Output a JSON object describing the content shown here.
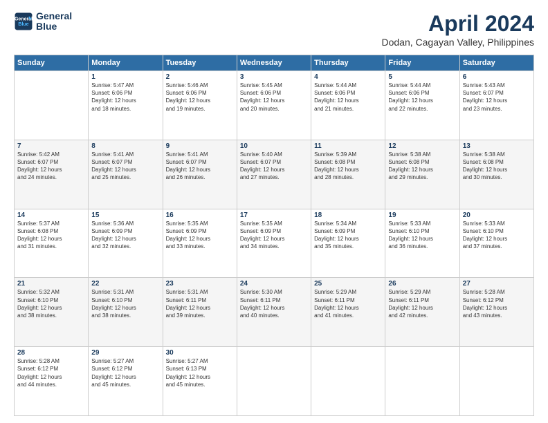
{
  "logo": {
    "line1": "General",
    "line2": "Blue"
  },
  "title": "April 2024",
  "subtitle": "Dodan, Cagayan Valley, Philippines",
  "days": [
    "Sunday",
    "Monday",
    "Tuesday",
    "Wednesday",
    "Thursday",
    "Friday",
    "Saturday"
  ],
  "weeks": [
    [
      {
        "day": "",
        "info": ""
      },
      {
        "day": "1",
        "info": "Sunrise: 5:47 AM\nSunset: 6:06 PM\nDaylight: 12 hours\nand 18 minutes."
      },
      {
        "day": "2",
        "info": "Sunrise: 5:46 AM\nSunset: 6:06 PM\nDaylight: 12 hours\nand 19 minutes."
      },
      {
        "day": "3",
        "info": "Sunrise: 5:45 AM\nSunset: 6:06 PM\nDaylight: 12 hours\nand 20 minutes."
      },
      {
        "day": "4",
        "info": "Sunrise: 5:44 AM\nSunset: 6:06 PM\nDaylight: 12 hours\nand 21 minutes."
      },
      {
        "day": "5",
        "info": "Sunrise: 5:44 AM\nSunset: 6:06 PM\nDaylight: 12 hours\nand 22 minutes."
      },
      {
        "day": "6",
        "info": "Sunrise: 5:43 AM\nSunset: 6:07 PM\nDaylight: 12 hours\nand 23 minutes."
      }
    ],
    [
      {
        "day": "7",
        "info": "Sunrise: 5:42 AM\nSunset: 6:07 PM\nDaylight: 12 hours\nand 24 minutes."
      },
      {
        "day": "8",
        "info": "Sunrise: 5:41 AM\nSunset: 6:07 PM\nDaylight: 12 hours\nand 25 minutes."
      },
      {
        "day": "9",
        "info": "Sunrise: 5:41 AM\nSunset: 6:07 PM\nDaylight: 12 hours\nand 26 minutes."
      },
      {
        "day": "10",
        "info": "Sunrise: 5:40 AM\nSunset: 6:07 PM\nDaylight: 12 hours\nand 27 minutes."
      },
      {
        "day": "11",
        "info": "Sunrise: 5:39 AM\nSunset: 6:08 PM\nDaylight: 12 hours\nand 28 minutes."
      },
      {
        "day": "12",
        "info": "Sunrise: 5:38 AM\nSunset: 6:08 PM\nDaylight: 12 hours\nand 29 minutes."
      },
      {
        "day": "13",
        "info": "Sunrise: 5:38 AM\nSunset: 6:08 PM\nDaylight: 12 hours\nand 30 minutes."
      }
    ],
    [
      {
        "day": "14",
        "info": "Sunrise: 5:37 AM\nSunset: 6:08 PM\nDaylight: 12 hours\nand 31 minutes."
      },
      {
        "day": "15",
        "info": "Sunrise: 5:36 AM\nSunset: 6:09 PM\nDaylight: 12 hours\nand 32 minutes."
      },
      {
        "day": "16",
        "info": "Sunrise: 5:35 AM\nSunset: 6:09 PM\nDaylight: 12 hours\nand 33 minutes."
      },
      {
        "day": "17",
        "info": "Sunrise: 5:35 AM\nSunset: 6:09 PM\nDaylight: 12 hours\nand 34 minutes."
      },
      {
        "day": "18",
        "info": "Sunrise: 5:34 AM\nSunset: 6:09 PM\nDaylight: 12 hours\nand 35 minutes."
      },
      {
        "day": "19",
        "info": "Sunrise: 5:33 AM\nSunset: 6:10 PM\nDaylight: 12 hours\nand 36 minutes."
      },
      {
        "day": "20",
        "info": "Sunrise: 5:33 AM\nSunset: 6:10 PM\nDaylight: 12 hours\nand 37 minutes."
      }
    ],
    [
      {
        "day": "21",
        "info": "Sunrise: 5:32 AM\nSunset: 6:10 PM\nDaylight: 12 hours\nand 38 minutes."
      },
      {
        "day": "22",
        "info": "Sunrise: 5:31 AM\nSunset: 6:10 PM\nDaylight: 12 hours\nand 38 minutes."
      },
      {
        "day": "23",
        "info": "Sunrise: 5:31 AM\nSunset: 6:11 PM\nDaylight: 12 hours\nand 39 minutes."
      },
      {
        "day": "24",
        "info": "Sunrise: 5:30 AM\nSunset: 6:11 PM\nDaylight: 12 hours\nand 40 minutes."
      },
      {
        "day": "25",
        "info": "Sunrise: 5:29 AM\nSunset: 6:11 PM\nDaylight: 12 hours\nand 41 minutes."
      },
      {
        "day": "26",
        "info": "Sunrise: 5:29 AM\nSunset: 6:11 PM\nDaylight: 12 hours\nand 42 minutes."
      },
      {
        "day": "27",
        "info": "Sunrise: 5:28 AM\nSunset: 6:12 PM\nDaylight: 12 hours\nand 43 minutes."
      }
    ],
    [
      {
        "day": "28",
        "info": "Sunrise: 5:28 AM\nSunset: 6:12 PM\nDaylight: 12 hours\nand 44 minutes."
      },
      {
        "day": "29",
        "info": "Sunrise: 5:27 AM\nSunset: 6:12 PM\nDaylight: 12 hours\nand 45 minutes."
      },
      {
        "day": "30",
        "info": "Sunrise: 5:27 AM\nSunset: 6:13 PM\nDaylight: 12 hours\nand 45 minutes."
      },
      {
        "day": "",
        "info": ""
      },
      {
        "day": "",
        "info": ""
      },
      {
        "day": "",
        "info": ""
      },
      {
        "day": "",
        "info": ""
      }
    ]
  ]
}
